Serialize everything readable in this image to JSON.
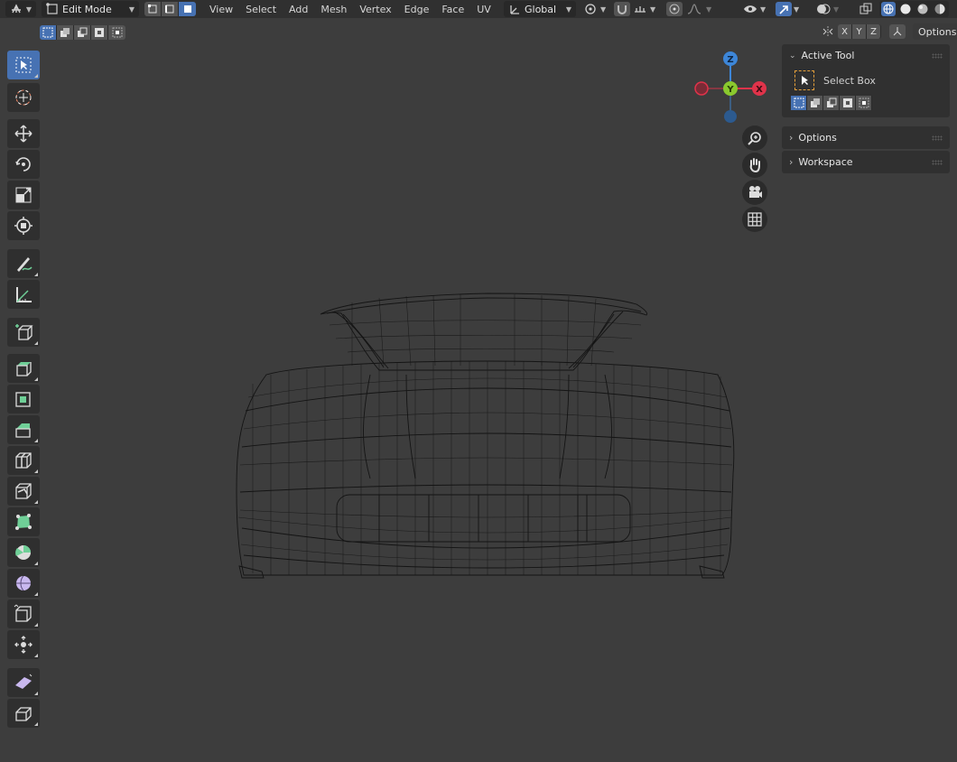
{
  "header": {
    "mode_label": "Edit Mode",
    "menus": [
      "View",
      "Select",
      "Add",
      "Mesh",
      "Vertex",
      "Edge",
      "Face",
      "UV"
    ],
    "transform_orientation": "Global"
  },
  "tool_settings": {
    "axis_labels": [
      "X",
      "Y",
      "Z"
    ],
    "options_label": "Options"
  },
  "sidebar": {
    "active_tool_title": "Active Tool",
    "active_tool_name": "Select Box",
    "options_title": "Options",
    "workspace_title": "Workspace"
  },
  "gizmo": {
    "z": "Z",
    "y": "Y",
    "x": "X"
  },
  "colors": {
    "accent": "#4772b3",
    "x_axis": "#e0334a",
    "y_axis": "#8ac92e",
    "z_axis": "#3d86d8",
    "mesh_wire": "#111111"
  },
  "toolbar_tools": [
    "select-box",
    "cursor",
    "move",
    "rotate",
    "scale",
    "transform",
    "annotate",
    "measure",
    "add-cube",
    "extrude-region",
    "inset-faces",
    "bevel",
    "loop-cut",
    "knife",
    "poly-build",
    "spin",
    "smooth",
    "edge-slide",
    "shrink-fatten",
    "shear",
    "rip-region"
  ]
}
